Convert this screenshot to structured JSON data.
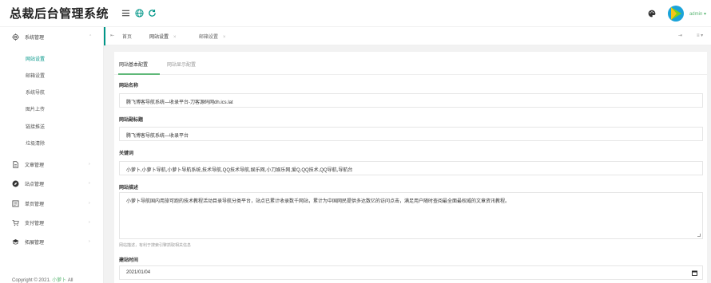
{
  "app": {
    "title": "总裁后台管理系统",
    "admin_name": "admin ▾",
    "brand_color": "#009688",
    "accent_color": "#5fb878"
  },
  "header_icons": [
    "menu-icon",
    "globe-icon",
    "refresh-icon",
    "palette-icon"
  ],
  "sidebar": {
    "groups": [
      {
        "icon": "gear-icon",
        "label": "系统管理",
        "arrow": "⌃"
      },
      {
        "icon": "document-icon",
        "label": "文章管理",
        "arrow": "›"
      },
      {
        "icon": "compass-icon",
        "label": "站点管理",
        "arrow": "›"
      },
      {
        "icon": "page-icon",
        "label": "单页管理",
        "arrow": "›"
      },
      {
        "icon": "cart-icon",
        "label": "支付管理",
        "arrow": "›"
      },
      {
        "icon": "extend-icon",
        "label": "拓展管理",
        "arrow": "›"
      }
    ],
    "subitems": [
      "网站设置",
      "邮箱设置",
      "系统导航",
      "图片上传",
      "链接推送",
      "垃圾清除"
    ],
    "copyright_prefix": "Copyright © 2021. ",
    "copyright_author": "小萝卜",
    "copyright_suffix": " All"
  },
  "tabbar": {
    "first_icon": "⇤",
    "tabs": [
      {
        "label": "首页",
        "close": ""
      },
      {
        "label": "网站设置",
        "close": "×"
      },
      {
        "label": "邮箱设置",
        "close": "×"
      }
    ],
    "right_icons": [
      "⇥",
      "≡ ▾"
    ]
  },
  "inner_tabs": [
    "网站基本配置",
    "网站显示配置"
  ],
  "form": {
    "site_name": {
      "label": "网站名称",
      "value": "腾飞博客导航系统—收录平台-刀客源码网dh.ics.lat"
    },
    "subtitle": {
      "label": "网站副标题",
      "value": "腾飞博客导航系统—收录平台"
    },
    "keywords": {
      "label": "关键词",
      "value": "小萝卜,小萝卜导航,小萝卜导航系统,技术导航,QQ技术导航,娱乐网,小刀娱乐网,爱Q,QQ技术,QQ导航,导航台"
    },
    "description": {
      "label": "网站描述",
      "value": "小萝卜导航国内用旅可跑的技术教程活动目录导航分类平台，站点已累计收录数千网站，累计为中国网民提供多达数亿的访问点击，满足用户随时查阅最全面最权威的文章资讯教程。",
      "help": "网站描述，有利于搜索引擎抓取相关信息"
    },
    "build_date": {
      "label": "建站时间",
      "value": "2021/01/04"
    }
  }
}
